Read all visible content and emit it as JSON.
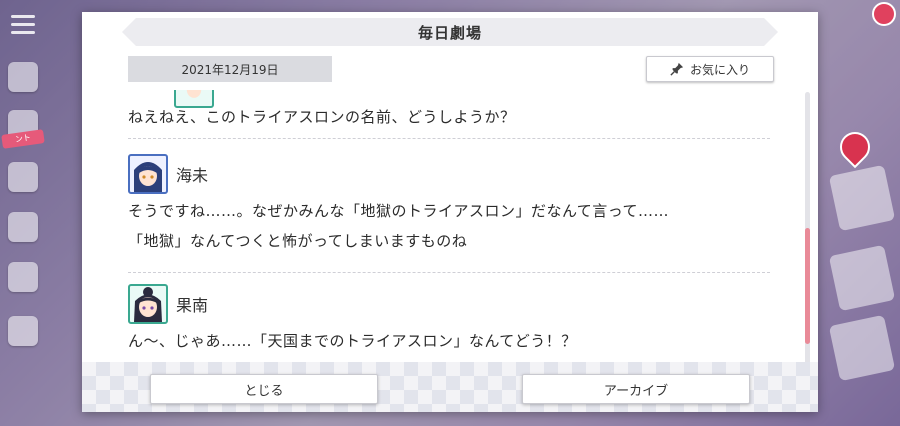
{
  "dialog": {
    "title": "毎日劇場",
    "date": "2021年12月19日",
    "favorite_label": "お気に入り",
    "messages": [
      {
        "speaker": "",
        "avatar_icon": "character-avatar-icon",
        "lines": [
          "ねえねえ、このトライアスロンの名前、どうしようか？"
        ]
      },
      {
        "speaker": "海未",
        "avatar_icon": "umi-avatar-icon",
        "lines": [
          "そうですね……。なぜかみんな「地獄のトライアスロン」だなんて言って……",
          "「地獄」なんてつくと怖がってしまいますものね"
        ]
      },
      {
        "speaker": "果南",
        "avatar_icon": "kanan-avatar-icon",
        "lines": [
          "ん〜、じゃあ……「天国までのトライアスロン」なんてどう！？"
        ]
      }
    ],
    "scroll_position": 0.85,
    "footer": {
      "close_label": "とじる",
      "archive_label": "アーカイブ"
    }
  },
  "background": {
    "badge_text": "ント"
  },
  "colors": {
    "accent_scroll": "#e98a98",
    "avatar_blue": "#4a6fc0",
    "avatar_green": "#3aa890"
  }
}
